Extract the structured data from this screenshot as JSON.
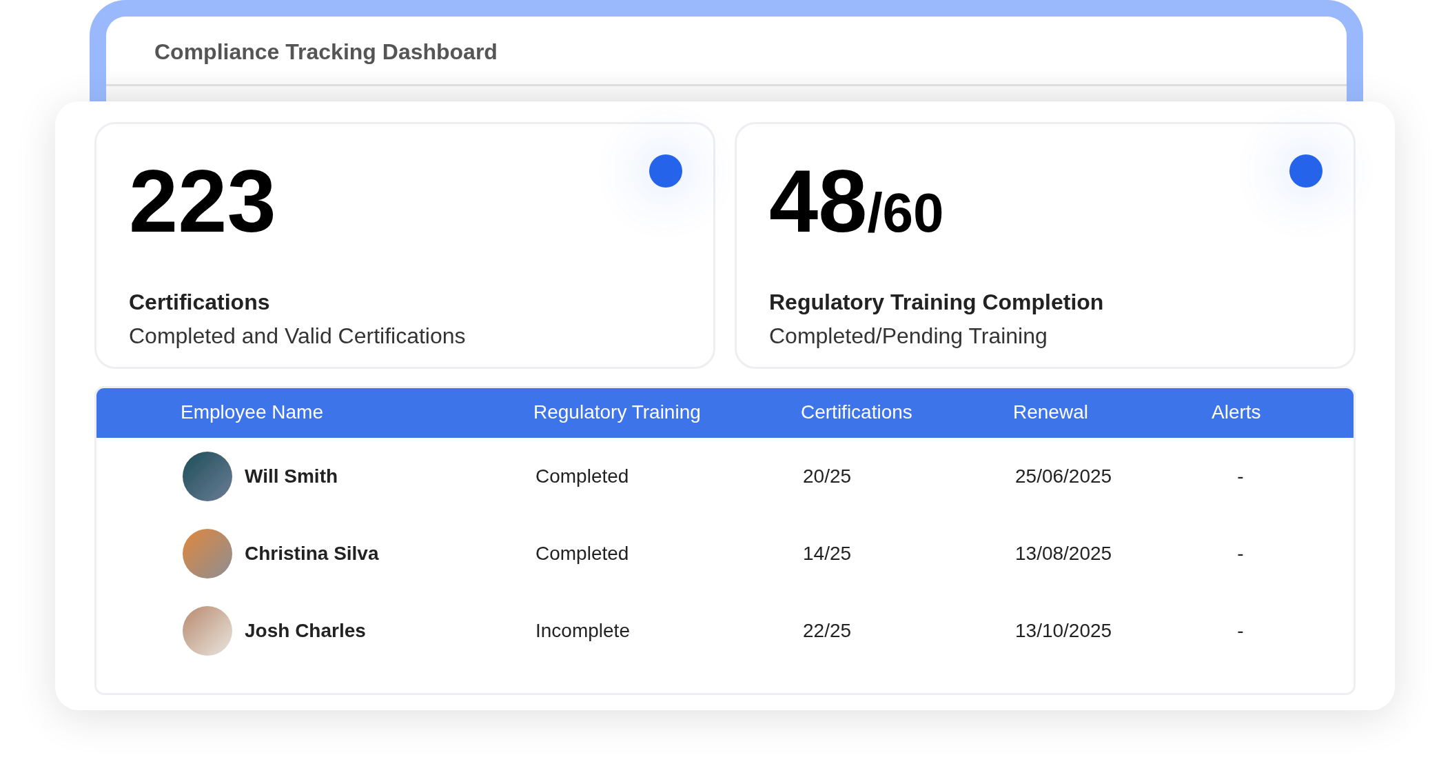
{
  "window": {
    "title": "Compliance Tracking Dashboard"
  },
  "stats": [
    {
      "value": "223",
      "label": "Certifications",
      "description": "Completed and Valid Certifications"
    },
    {
      "value": "48",
      "total": "/60",
      "label": "Regulatory Training Completion",
      "description": "Completed/Pending Training"
    }
  ],
  "table": {
    "columns": [
      "Employee Name",
      "Regulatory Training",
      "Certifications",
      "Renewal",
      "Alerts"
    ],
    "rows": [
      {
        "name": "Will Smith",
        "training": "Completed",
        "certifications": "20/25",
        "renewal": "25/06/2025",
        "alerts": "-"
      },
      {
        "name": "Christina Silva",
        "training": "Completed",
        "certifications": "14/25",
        "renewal": "13/08/2025",
        "alerts": "-"
      },
      {
        "name": "Josh Charles",
        "training": "Incomplete",
        "certifications": "22/25",
        "renewal": "13/10/2025",
        "alerts": "-"
      }
    ]
  }
}
